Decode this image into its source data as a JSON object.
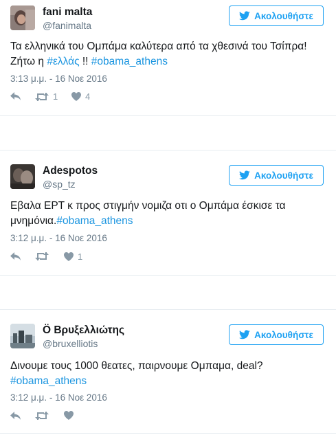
{
  "icons": {
    "follow": "twitter-bird-icon",
    "reply": "reply-icon",
    "retweet": "retweet-icon",
    "like": "heart-icon"
  },
  "colors": {
    "accent": "#1da1f2",
    "hashtag": "#1b95e0",
    "muted": "#657786",
    "icon": "#8899a6"
  },
  "tweets": [
    {
      "name": "fani malta",
      "handle": "@fanimalta",
      "follow_label": "Ακολουθήστε",
      "text_plain_1": "Τα ελληνικά του Ομπάμα καλύτερα από τα χθεσινά του Τσίπρα! Ζήτω η ",
      "hashtag_1": "#ελλάς",
      "text_plain_2": " !! ",
      "hashtag_2": "#obama_athens",
      "time": "3:13 μ.μ. - 16 Νοε 2016",
      "retweets": "1",
      "likes": "4"
    },
    {
      "name": "Adespotos",
      "handle": "@sp_tz",
      "follow_label": "Ακολουθήστε",
      "text_plain_1": "Εβαλα ΕΡΤ κ προς στιγμήν νομιζα οτι ο Ομπάμα έσκισε τα μνημόνια.",
      "hashtag_1": "#obama_athens",
      "time": "3:12 μ.μ. - 16 Νοε 2016",
      "retweets": "",
      "likes": "1"
    },
    {
      "name": "Ö Βρυξελλιώτης",
      "handle": "@bruxelliotis",
      "follow_label": "Ακολουθήστε",
      "text_plain_1": "Δινουμε τους 1000 θεατες, παιρνουμε Ομπαμα, deal? ",
      "hashtag_1": "#obama_athens",
      "time": "3:12 μ.μ. - 16 Νοε 2016",
      "retweets": "",
      "likes": ""
    }
  ]
}
